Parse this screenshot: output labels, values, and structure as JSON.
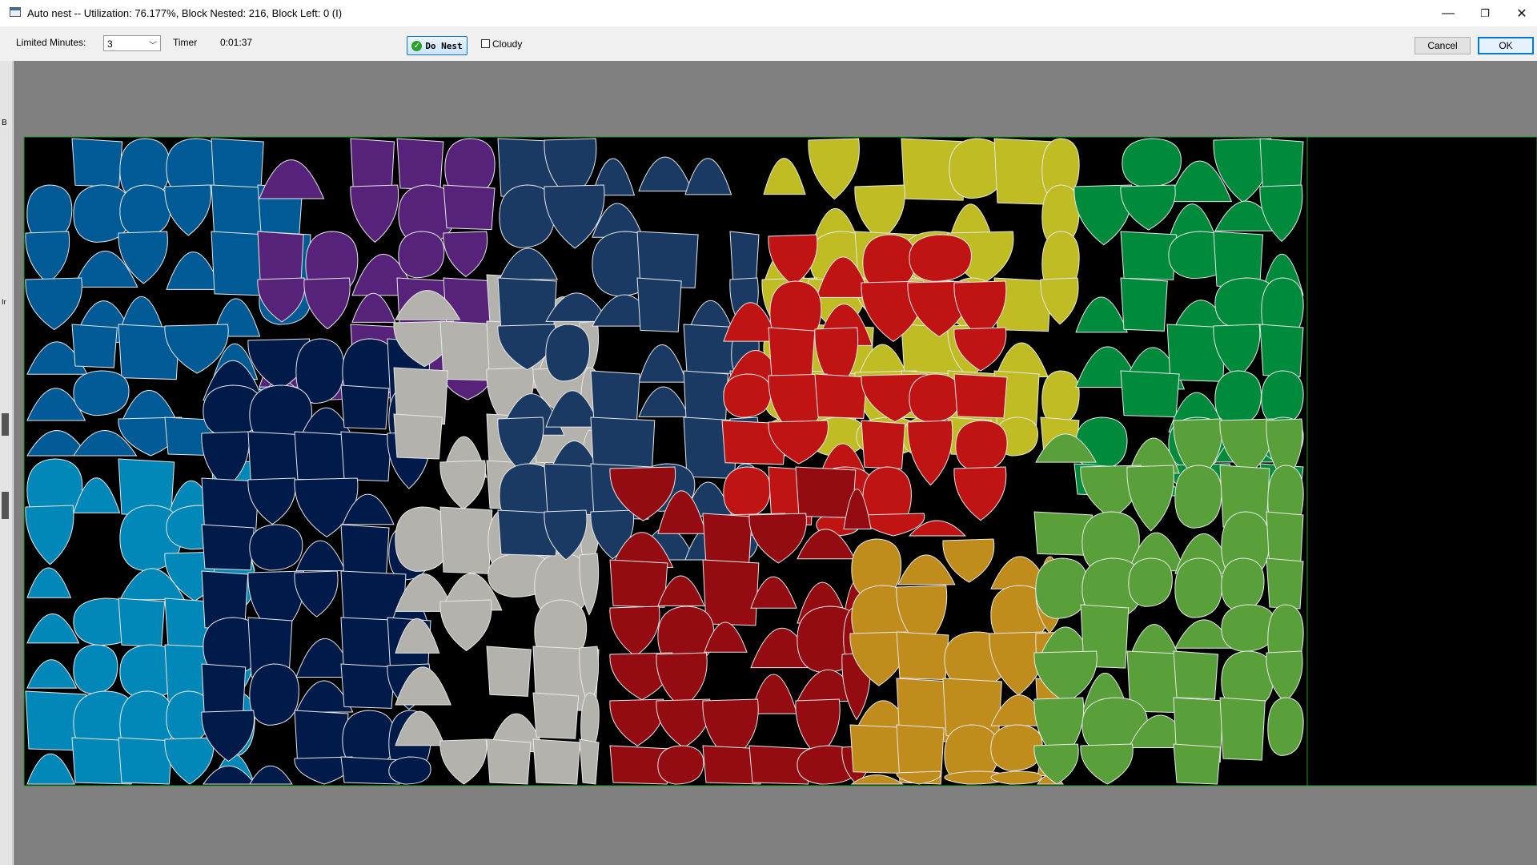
{
  "window": {
    "title": "Auto nest --  Utilization: 76.177%, Block Nested: 216, Block Left: 0   (I)",
    "controls": {
      "minimize": "—",
      "restore": "❐",
      "close": "✕"
    }
  },
  "toolbar": {
    "limited_minutes_label": "Limited Minutes:",
    "limited_minutes_value": "3",
    "timer_label": "Timer",
    "timer_value": "0:01:37",
    "do_nest_label": "Do Nest",
    "cloudy_label": "Cloudy",
    "cloudy_checked": false,
    "cancel_label": "Cancel",
    "ok_label": "OK"
  },
  "left_strip": {
    "labels": [
      "B",
      "Ir"
    ]
  },
  "colors": {
    "sheet_bg": "#000000",
    "sheet_border": "#1c9c1c",
    "canvas_bg": "#808080",
    "groups": [
      "#005a96",
      "#0288b8",
      "#57237a",
      "#001a4a",
      "#b4b2ac",
      "#1a3a64",
      "#c0bd24",
      "#c01414",
      "#940c12",
      "#c08c1c",
      "#008a3c",
      "#5aa03a"
    ]
  }
}
